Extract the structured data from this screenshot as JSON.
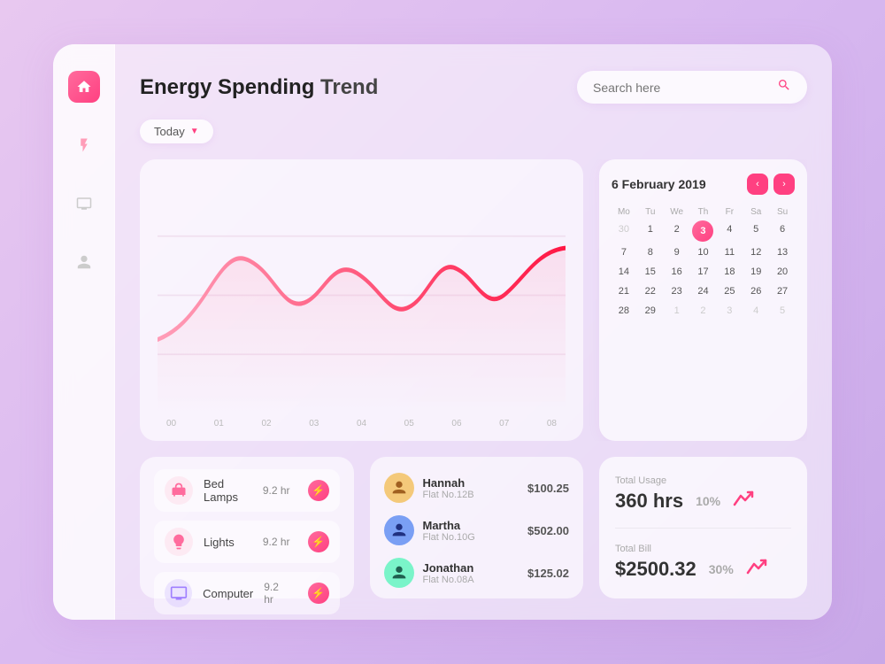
{
  "app": {
    "title": "Energy Spending Trend"
  },
  "header": {
    "title_bold": "Energy Spending",
    "title_regular": " Trend",
    "search_placeholder": "Search here",
    "filter_label": "Today"
  },
  "sidebar": {
    "icons": [
      {
        "name": "home-icon",
        "label": "Home",
        "active": true
      },
      {
        "name": "lightning-icon",
        "label": "Energy",
        "active": false
      },
      {
        "name": "video-icon",
        "label": "Monitor",
        "active": false
      },
      {
        "name": "user-icon",
        "label": "Profile",
        "active": false
      }
    ]
  },
  "chart": {
    "x_labels": [
      "00",
      "01",
      "02",
      "03",
      "04",
      "05",
      "06",
      "07",
      "08"
    ]
  },
  "calendar": {
    "month_year": "6 February  2019",
    "day_headers": [
      "Mo",
      "Tu",
      "We",
      "Th",
      "Fr",
      "Sa",
      "Su"
    ],
    "days": [
      {
        "day": "30",
        "type": "prev"
      },
      {
        "day": "1",
        "type": "normal"
      },
      {
        "day": "2",
        "type": "normal"
      },
      {
        "day": "3",
        "type": "today"
      },
      {
        "day": "4",
        "type": "normal"
      },
      {
        "day": "5",
        "type": "normal"
      },
      {
        "day": "6",
        "type": "normal"
      },
      {
        "day": "7",
        "type": "normal"
      },
      {
        "day": "8",
        "type": "normal"
      },
      {
        "day": "9",
        "type": "normal"
      },
      {
        "day": "10",
        "type": "normal"
      },
      {
        "day": "11",
        "type": "normal"
      },
      {
        "day": "12",
        "type": "normal"
      },
      {
        "day": "13",
        "type": "normal"
      },
      {
        "day": "14",
        "type": "normal"
      },
      {
        "day": "15",
        "type": "normal"
      },
      {
        "day": "16",
        "type": "normal"
      },
      {
        "day": "17",
        "type": "normal"
      },
      {
        "day": "18",
        "type": "normal"
      },
      {
        "day": "19",
        "type": "normal"
      },
      {
        "day": "20",
        "type": "normal"
      },
      {
        "day": "21",
        "type": "normal"
      },
      {
        "day": "22",
        "type": "normal"
      },
      {
        "day": "23",
        "type": "normal"
      },
      {
        "day": "24",
        "type": "normal"
      },
      {
        "day": "25",
        "type": "normal"
      },
      {
        "day": "26",
        "type": "normal"
      },
      {
        "day": "27",
        "type": "normal"
      },
      {
        "day": "28",
        "type": "normal"
      },
      {
        "day": "29",
        "type": "normal"
      },
      {
        "day": "1",
        "type": "next"
      },
      {
        "day": "2",
        "type": "next"
      },
      {
        "day": "3",
        "type": "next"
      },
      {
        "day": "4",
        "type": "next"
      },
      {
        "day": "5",
        "type": "next"
      }
    ]
  },
  "appliances": {
    "items": [
      {
        "name": "Bed Lamps",
        "hours": "9.2 hr",
        "icon": "🪔"
      },
      {
        "name": "Lights",
        "hours": "9.2 hr",
        "icon": "💡"
      },
      {
        "name": "Computer",
        "hours": "9.2 hr",
        "icon": "🖥️"
      }
    ]
  },
  "tenants": {
    "items": [
      {
        "name": "Hannah",
        "flat": "Flat No.12B",
        "amount": "$100.25",
        "avatar": "👩"
      },
      {
        "name": "Martha",
        "flat": "Flat No.10G",
        "amount": "$502.00",
        "avatar": "👩"
      },
      {
        "name": "Jonathan",
        "flat": "Flat No.08A",
        "amount": "$125.02",
        "avatar": "👨"
      }
    ]
  },
  "stats": {
    "total_usage_label": "Total Usage",
    "total_usage_value": "360 hrs",
    "total_usage_change": "10%",
    "total_bill_label": "Total Bill",
    "total_bill_value": "$2500.32",
    "total_bill_change": "30%"
  },
  "colors": {
    "accent": "#ff4081",
    "accent_light": "#ff6b9d",
    "bg_gradient_start": "#e8c8f0",
    "bg_gradient_end": "#c8a8e8"
  }
}
